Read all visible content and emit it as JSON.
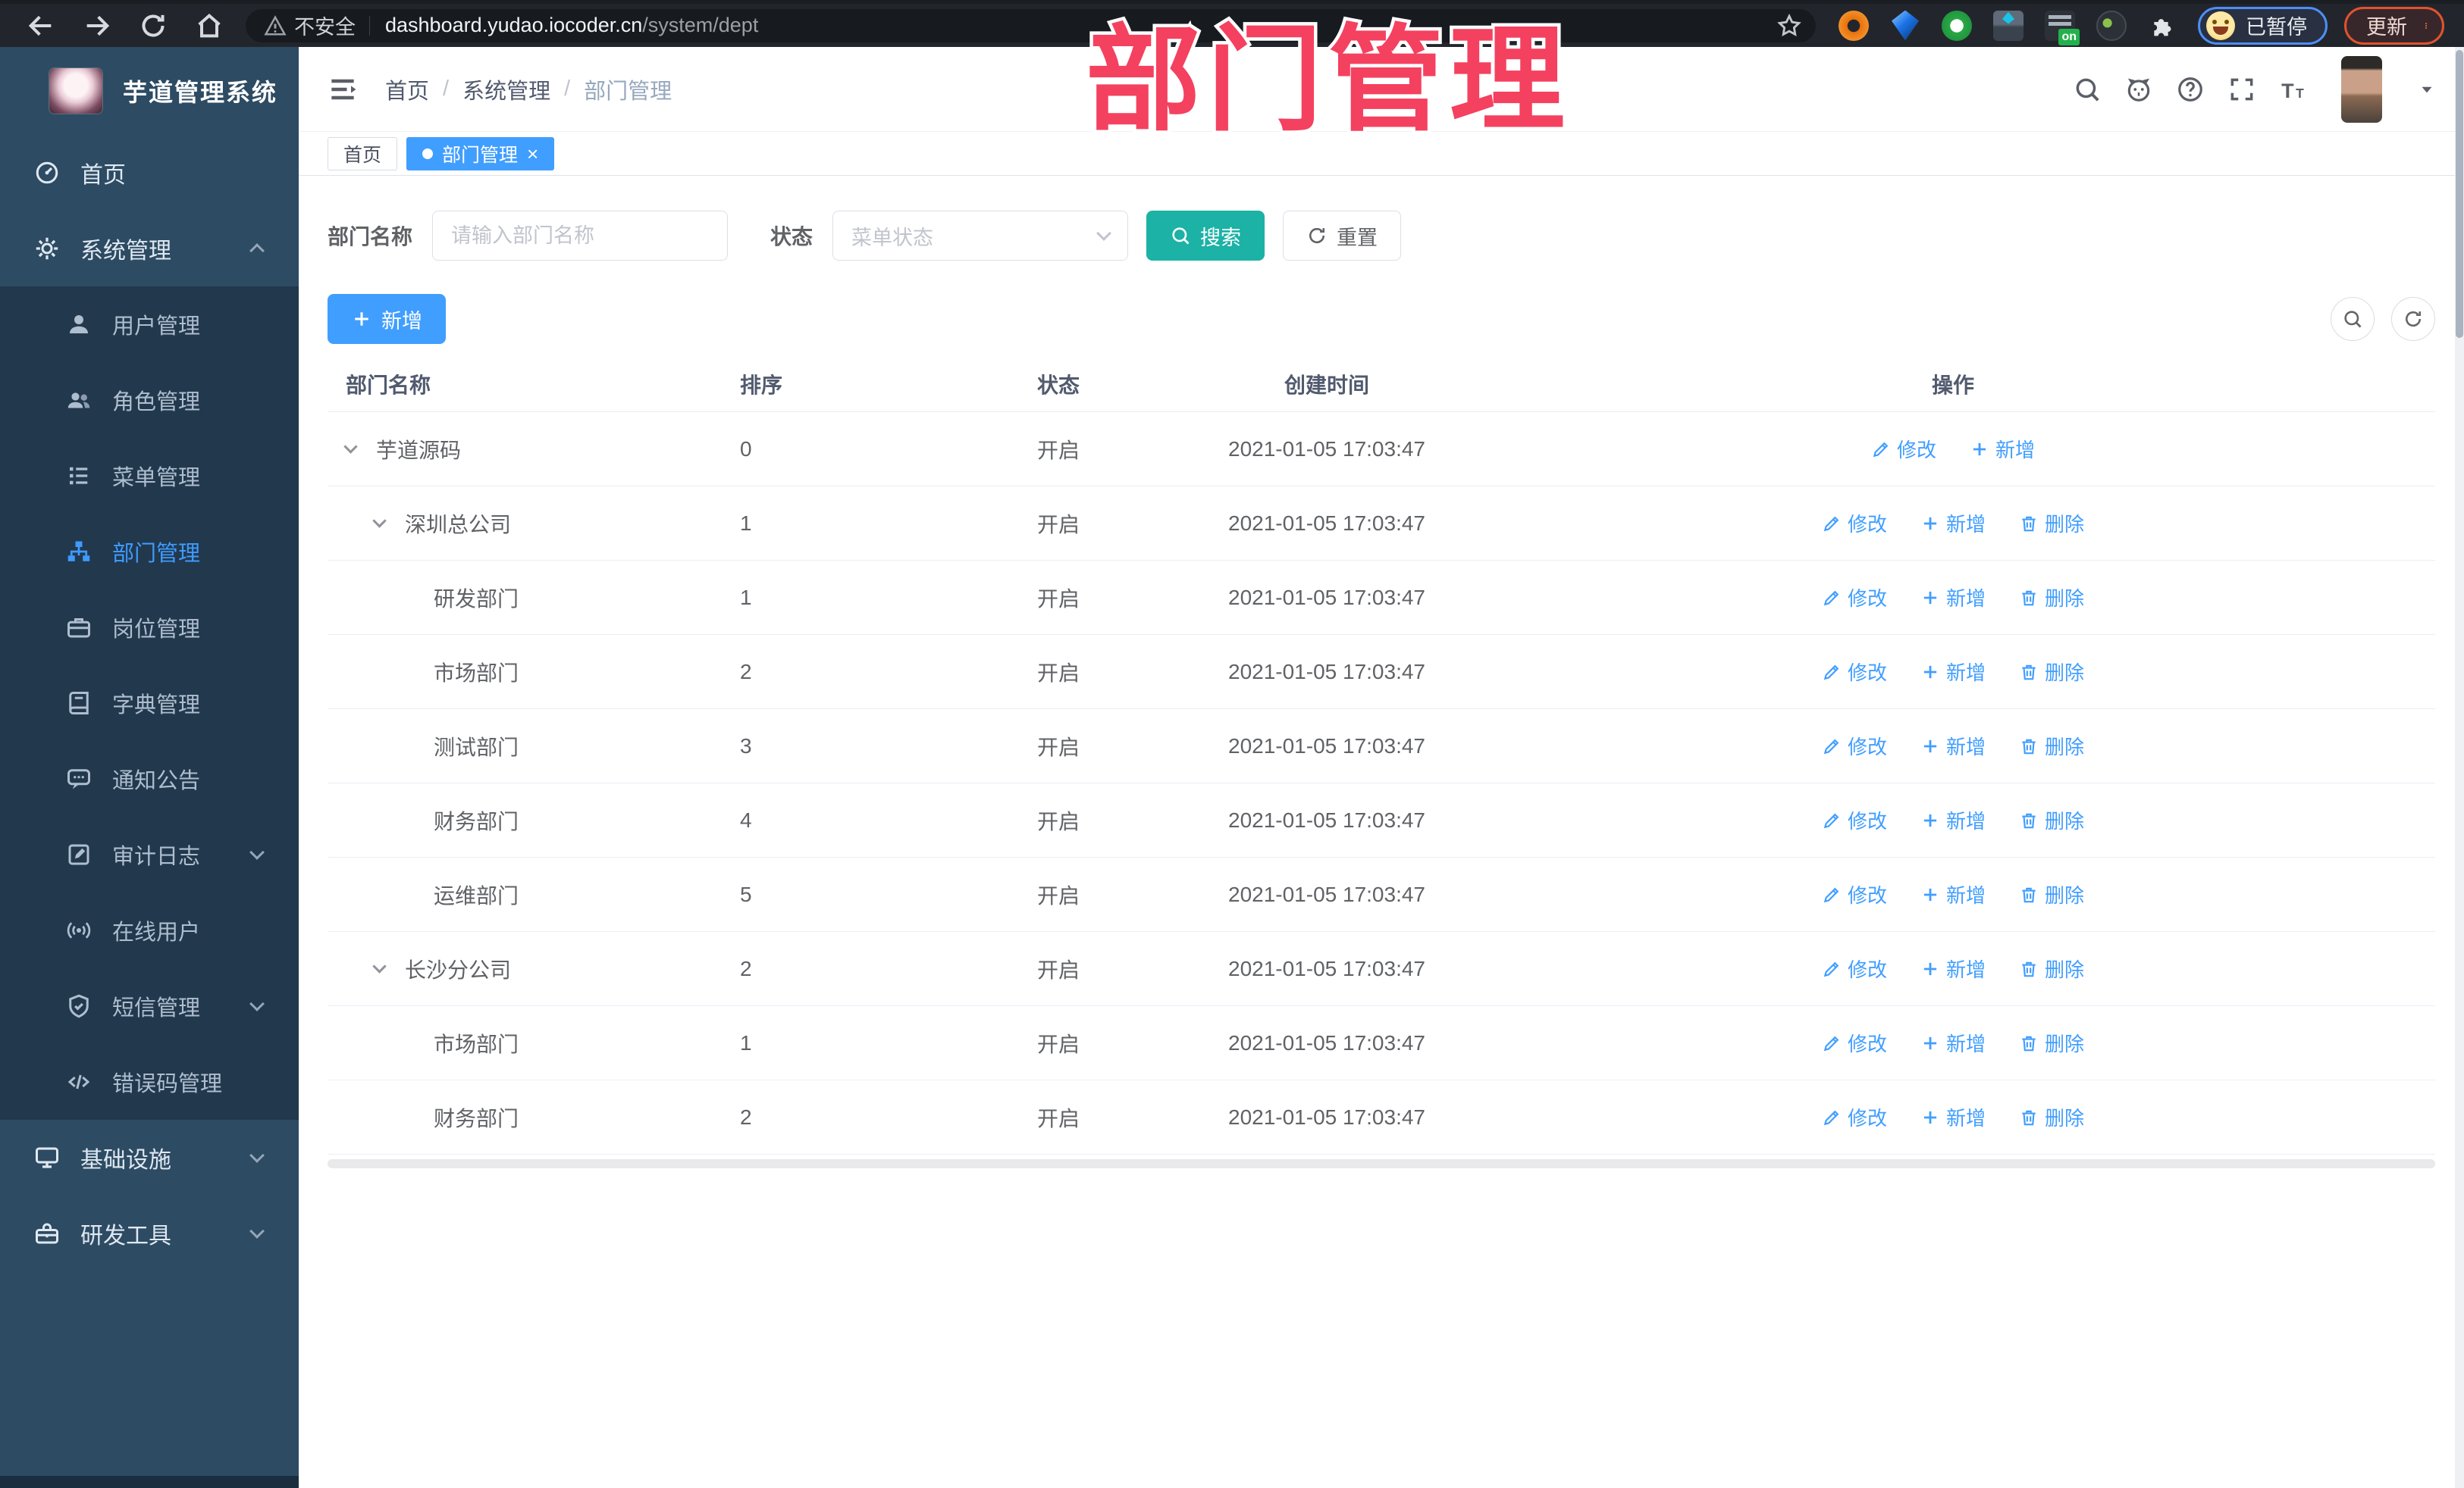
{
  "annotation": {
    "title": "部门管理",
    "color": "#f4415f"
  },
  "browser": {
    "insecure_label": "不安全",
    "url_host": "dashboard.yudao.iocoder.cn",
    "url_path": "/system/dept",
    "profile_label": "已暂停",
    "update_label": "更新",
    "extensions": [
      "orange-extension",
      "gem-extension",
      "green-circle-extension",
      "squares-extension",
      "dark-on-extension",
      "monkey-extension"
    ]
  },
  "sidebar": {
    "logo_title": "芋道管理系统",
    "items": [
      {
        "key": "home",
        "label": "首页",
        "icon": "dashboard",
        "type": "top"
      },
      {
        "key": "system",
        "label": "系统管理",
        "icon": "gear",
        "type": "top",
        "chevron": "up"
      },
      {
        "key": "user",
        "label": "用户管理",
        "icon": "user",
        "type": "sub"
      },
      {
        "key": "role",
        "label": "角色管理",
        "icon": "users",
        "type": "sub"
      },
      {
        "key": "menu",
        "label": "菜单管理",
        "icon": "list",
        "type": "sub"
      },
      {
        "key": "dept",
        "label": "部门管理",
        "icon": "tree",
        "type": "sub",
        "active": true
      },
      {
        "key": "post",
        "label": "岗位管理",
        "icon": "briefcase",
        "type": "sub"
      },
      {
        "key": "dict",
        "label": "字典管理",
        "icon": "book",
        "type": "sub"
      },
      {
        "key": "notice",
        "label": "通知公告",
        "icon": "anno",
        "type": "sub"
      },
      {
        "key": "audit",
        "label": "审计日志",
        "icon": "audit",
        "type": "sub",
        "chevron": "down"
      },
      {
        "key": "online",
        "label": "在线用户",
        "icon": "online",
        "type": "sub"
      },
      {
        "key": "sms",
        "label": "短信管理",
        "icon": "shield",
        "type": "sub",
        "chevron": "down"
      },
      {
        "key": "errcode",
        "label": "错误码管理",
        "icon": "code",
        "type": "sub"
      },
      {
        "key": "infra",
        "label": "基础设施",
        "icon": "monitor",
        "type": "top",
        "chevron": "down"
      },
      {
        "key": "devtools",
        "label": "研发工具",
        "icon": "toolbox",
        "type": "top",
        "chevron": "down"
      }
    ]
  },
  "header": {
    "breadcrumb": [
      "首页",
      "系统管理",
      "部门管理"
    ]
  },
  "tags": [
    {
      "label": "首页",
      "active": false
    },
    {
      "label": "部门管理",
      "active": true
    }
  ],
  "filter": {
    "dept_label": "部门名称",
    "dept_placeholder": "请输入部门名称",
    "status_label": "状态",
    "status_placeholder": "菜单状态",
    "search_label": "搜索",
    "reset_label": "重置"
  },
  "toolbar": {
    "add_label": "新增"
  },
  "table": {
    "columns": [
      "部门名称",
      "排序",
      "状态",
      "创建时间",
      "操作"
    ],
    "action_labels": {
      "edit": "修改",
      "add": "新增",
      "delete": "删除"
    },
    "rows": [
      {
        "name": "芋道源码",
        "level": 0,
        "expanded": true,
        "sort": "0",
        "status": "开启",
        "created": "2021-01-05 17:03:47",
        "actions": [
          "edit",
          "add"
        ]
      },
      {
        "name": "深圳总公司",
        "level": 1,
        "expanded": true,
        "sort": "1",
        "status": "开启",
        "created": "2021-01-05 17:03:47",
        "actions": [
          "edit",
          "add",
          "delete"
        ]
      },
      {
        "name": "研发部门",
        "level": 2,
        "expanded": false,
        "sort": "1",
        "status": "开启",
        "created": "2021-01-05 17:03:47",
        "actions": [
          "edit",
          "add",
          "delete"
        ]
      },
      {
        "name": "市场部门",
        "level": 2,
        "expanded": false,
        "sort": "2",
        "status": "开启",
        "created": "2021-01-05 17:03:47",
        "actions": [
          "edit",
          "add",
          "delete"
        ]
      },
      {
        "name": "测试部门",
        "level": 2,
        "expanded": false,
        "sort": "3",
        "status": "开启",
        "created": "2021-01-05 17:03:47",
        "actions": [
          "edit",
          "add",
          "delete"
        ]
      },
      {
        "name": "财务部门",
        "level": 2,
        "expanded": false,
        "sort": "4",
        "status": "开启",
        "created": "2021-01-05 17:03:47",
        "actions": [
          "edit",
          "add",
          "delete"
        ]
      },
      {
        "name": "运维部门",
        "level": 2,
        "expanded": false,
        "sort": "5",
        "status": "开启",
        "created": "2021-01-05 17:03:47",
        "actions": [
          "edit",
          "add",
          "delete"
        ]
      },
      {
        "name": "长沙分公司",
        "level": 1,
        "expanded": true,
        "sort": "2",
        "status": "开启",
        "created": "2021-01-05 17:03:47",
        "actions": [
          "edit",
          "add",
          "delete"
        ]
      },
      {
        "name": "市场部门",
        "level": 2,
        "expanded": false,
        "sort": "1",
        "status": "开启",
        "created": "2021-01-05 17:03:47",
        "actions": [
          "edit",
          "add",
          "delete"
        ]
      },
      {
        "name": "财务部门",
        "level": 2,
        "expanded": false,
        "sort": "2",
        "status": "开启",
        "created": "2021-01-05 17:03:47",
        "actions": [
          "edit",
          "add",
          "delete"
        ]
      }
    ]
  }
}
